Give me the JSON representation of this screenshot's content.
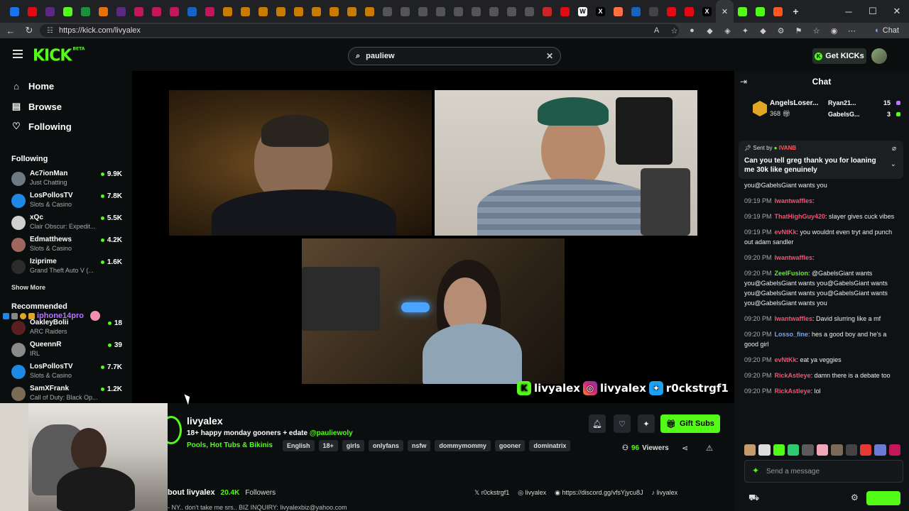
{
  "browser": {
    "url": "https://kick.com/livyalex",
    "chat_button_label": "Chat"
  },
  "header": {
    "logo": "KICK",
    "logo_sup": "BETA",
    "search_value": "pauliew",
    "get_kicks_label": "Get KICKs"
  },
  "sidebar": {
    "nav": [
      {
        "label": "Home",
        "icon": "home-icon"
      },
      {
        "label": "Browse",
        "icon": "browse-icon"
      },
      {
        "label": "Following",
        "icon": "heart-icon"
      }
    ],
    "following_heading": "Following",
    "following": [
      {
        "name": "Ac7ionMan",
        "category": "Just Chatting",
        "viewers": "9.9K"
      },
      {
        "name": "LosPollosTV",
        "category": "Slots & Casino",
        "viewers": "7.8K"
      },
      {
        "name": "xQc",
        "category": "Clair Obscur: Expedit...",
        "viewers": "5.5K"
      },
      {
        "name": "Edmatthews",
        "category": "Slots & Casino",
        "viewers": "4.2K"
      },
      {
        "name": "Iziprime",
        "category": "Grand Theft Auto V (...",
        "viewers": "1.6K"
      }
    ],
    "show_more": "Show More",
    "recommended_heading": "Recommended",
    "overlay_user": "iphone14pro",
    "recommended": [
      {
        "name": "OakleyBolii",
        "category": "ARC Raiders",
        "viewers": "18"
      },
      {
        "name": "QueennR",
        "category": "IRL",
        "viewers": "39"
      },
      {
        "name": "LosPollosTV",
        "category": "Slots & Casino",
        "viewers": "7.7K"
      },
      {
        "name": "SamXFrank",
        "category": "Call of Duty: Black Op...",
        "viewers": "1.2K"
      }
    ]
  },
  "player": {
    "socials": [
      "livyalex",
      "livyalex",
      "r0ckstrgf1"
    ]
  },
  "stream": {
    "streamer": "livyalex",
    "title": "18+ happy monday gooners + edate ",
    "title_mention": "@pauliewoly",
    "category": "Pools, Hot Tubs & Bikinis",
    "tags": [
      "English",
      "18+",
      "girls",
      "onlyfans",
      "nsfw",
      "dommymommy",
      "gooner",
      "dominatrix"
    ],
    "gift_label": "Gift Subs",
    "viewers": "96",
    "viewers_label": "Viewers",
    "about_label": "bout livyalex",
    "followers": "20.4K",
    "followers_label": "Followers",
    "links": [
      "r0ckstrgf1",
      "livyalex",
      "https://discord.gg/vfsYjycu8J",
      "livyalex"
    ],
    "bio": "- NY.. don't take me srs.. BIZ INQUIRY: livyalexbiz@yahoo.com"
  },
  "chat": {
    "title": "Chat",
    "leaderboard": {
      "top_name": "AngelsLoser...",
      "top_count": "368",
      "second_name": "Ryan21...",
      "second_count": "15",
      "third_name": "GabelsG...",
      "third_count": "3"
    },
    "pinned": {
      "sent_by_label": "Sent by",
      "sender": "IVANB",
      "message": "Can you tell greg thank you for loaning me 30k like genuinely"
    },
    "messages": [
      {
        "time": "",
        "user": "",
        "color": "#eeeeee",
        "text": "you@GabelsGiant wants you"
      },
      {
        "time": "09:19 PM",
        "user": "Iwantwaffles",
        "color": "#ff4d6d",
        "text": ":"
      },
      {
        "time": "09:19 PM",
        "user": "ThatHighGuy420",
        "color": "#ff4d6d",
        "text": ": slayer gives cuck vibes"
      },
      {
        "time": "09:19 PM",
        "user": "evNtKk",
        "color": "#ff4d6d",
        "text": ": you wouldnt even tryt and punch out adam sandler"
      },
      {
        "time": "09:20 PM",
        "user": "Iwantwaffles",
        "color": "#ff4d6d",
        "text": ":"
      },
      {
        "time": "09:20 PM",
        "user": "ZeelFusion",
        "color": "#53fc18",
        "text": ": @GabelsGiant wants you@GabelsGiant wants you@GabelsGiant wants you@GabelsGiant wants you@GabelsGiant wants you@GabelsGiant wants you"
      },
      {
        "time": "09:20 PM",
        "user": "Iwantwaffles",
        "color": "#ff4d6d",
        "text": ": David slurring like a mf"
      },
      {
        "time": "09:20 PM",
        "user": "Losso_fine",
        "color": "#6fa8ff",
        "text": ": hes a good boy and he's a good girl"
      },
      {
        "time": "09:20 PM",
        "user": "evNtKk",
        "color": "#ff4d6d",
        "text": ": eat ya veggies"
      },
      {
        "time": "09:20 PM",
        "user": "RickAstleye",
        "color": "#ff4d6d",
        "text": ": damn there is a debate too"
      },
      {
        "time": "09:20 PM",
        "user": "RickAstleye",
        "color": "#ff4d6d",
        "text": ": lol"
      }
    ],
    "send_placeholder": "Send a message"
  }
}
